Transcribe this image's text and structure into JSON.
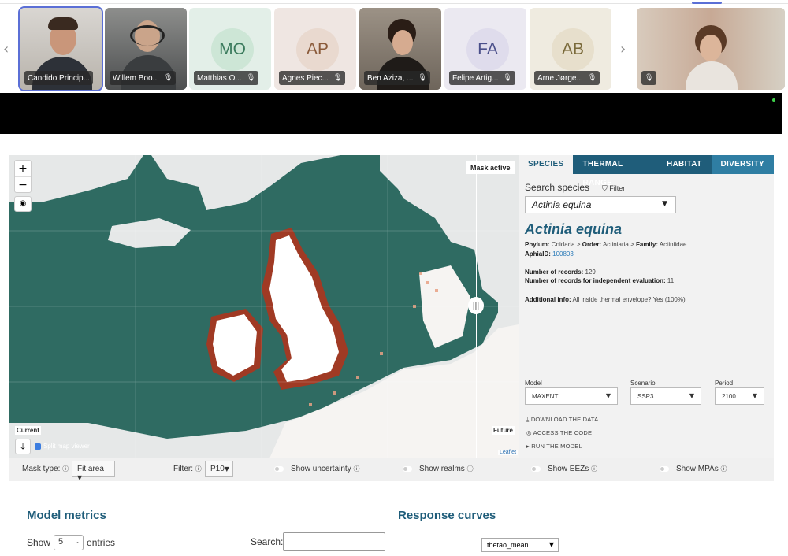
{
  "strip": {
    "participants": [
      {
        "name": "Candido Princip...",
        "type": "video",
        "selected": true
      },
      {
        "name": "Willem Boo...",
        "type": "video"
      },
      {
        "name": "Matthias O...",
        "initials": "MO",
        "bg": "#e3efe8",
        "circle": "#cde6d6"
      },
      {
        "name": "Agnes Piec...",
        "initials": "AP",
        "bg": "#efe6e2",
        "circle": "#e9d9cf"
      },
      {
        "name": "Ben Aziza, ...",
        "type": "video"
      },
      {
        "name": "Felipe Artig...",
        "initials": "FA",
        "bg": "#ebe9f1",
        "circle": "#dfdcec"
      },
      {
        "name": "Arne Jørge...",
        "initials": "AB",
        "bg": "#efebe0",
        "circle": "#e7dfcc"
      }
    ],
    "prev_arrow": "‹",
    "next_arrow": "›",
    "mic_icon": "🎙"
  },
  "map": {
    "zoom_in": "+",
    "zoom_out": "−",
    "eye_icon": "◉",
    "mask_active": "Mask active",
    "split_handle": "|||",
    "label_current": "Current",
    "label_future": "Future",
    "download_icon": "⤓",
    "split_viewer_label": "Split map viewer",
    "attribution": "Leaflet",
    "colors": {
      "sea": "#2f6b62",
      "land": "#e6e8e8",
      "core": "#ffffff",
      "edge": "#a03a24"
    }
  },
  "panel": {
    "tabs": [
      "SPECIES",
      "THERMAL RANGE",
      "HABITAT",
      "DIVERSITY"
    ],
    "search_label": "Search species",
    "filter_label": "Filter",
    "selected_species": "Actinia equina",
    "species_title": "Actinia equina",
    "taxonomy": {
      "phylum_label": "Phylum:",
      "phylum": "Cnidaria",
      "order_label": "Order:",
      "order": "Actiniaria",
      "family_label": "Family:",
      "family": "Actiniidae",
      "aphia_label": "AphiaID:",
      "aphia_id": "100803"
    },
    "records_label": "Number of records:",
    "records": "129",
    "indep_label": "Number of records for independent evaluation:",
    "indep": "11",
    "additional_label": "Additional info:",
    "additional": "All inside thermal envelope? Yes (100%)",
    "model_label": "Model",
    "model_value": "MAXENT",
    "scenario_label": "Scenario",
    "scenario_value": "SSP3",
    "period_label": "Period",
    "period_value": "2100",
    "links": [
      "DOWNLOAD THE DATA",
      "ACCESS THE CODE",
      "RUN THE MODEL"
    ],
    "link_icons": [
      "⤓",
      "◎",
      "▸"
    ]
  },
  "controls": {
    "mask_type_label": "Mask type:",
    "mask_type_value": "Fit area",
    "filter_label": "Filter:",
    "filter_value": "P10",
    "show_uncertainty": "Show uncertainty",
    "show_realms": "Show realms",
    "show_eezs": "Show EEZs",
    "show_mpas": "Show MPAs",
    "info_icon": "ⓘ"
  },
  "bottom": {
    "model_metrics_title": "Model metrics",
    "show": "Show",
    "entries_value": "5",
    "entries": "entries",
    "search_label": "Search:",
    "response_curves_title": "Response curves",
    "variable_value": "thetao_mean"
  }
}
